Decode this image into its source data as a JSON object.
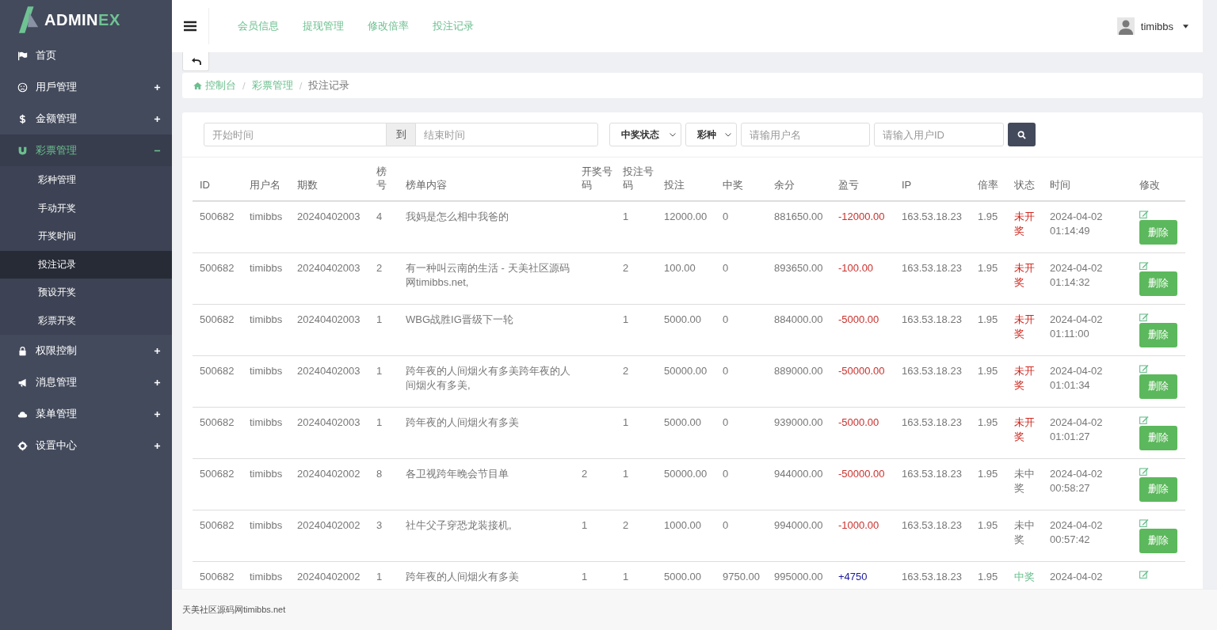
{
  "brand": {
    "name_main": "ADMIN",
    "name_accent": "EX"
  },
  "sidebar": {
    "items": [
      {
        "label": "首页",
        "expandable": false,
        "expanded": false
      },
      {
        "label": "用戶管理",
        "expandable": true,
        "expanded": false
      },
      {
        "label": "金额管理",
        "expandable": true,
        "expanded": false
      },
      {
        "label": "彩票管理",
        "expandable": true,
        "expanded": true,
        "children": [
          {
            "label": "彩种管理",
            "selected": false
          },
          {
            "label": "手动开奖",
            "selected": false
          },
          {
            "label": "开奖时间",
            "selected": false
          },
          {
            "label": "投注记录",
            "selected": true
          },
          {
            "label": "预设开奖",
            "selected": false
          },
          {
            "label": "彩票开奖",
            "selected": false
          }
        ]
      },
      {
        "label": "权限控制",
        "expandable": true,
        "expanded": false
      },
      {
        "label": "消息管理",
        "expandable": true,
        "expanded": false
      },
      {
        "label": "菜单管理",
        "expandable": true,
        "expanded": false
      },
      {
        "label": "设置中心",
        "expandable": true,
        "expanded": false
      }
    ]
  },
  "top_nav": {
    "links": [
      "会员信息",
      "提现管理",
      "修改倍率",
      "投注记录"
    ],
    "user": "timibbs"
  },
  "breadcrumb": {
    "separator": "/",
    "items": [
      {
        "label": "控制台",
        "current": false
      },
      {
        "label": "彩票管理",
        "current": false
      },
      {
        "label": "投注记录",
        "current": true
      }
    ]
  },
  "filters": {
    "start_time": {
      "placeholder": "开始时间"
    },
    "range_separator": "到",
    "end_time": {
      "placeholder": "结束时间"
    },
    "win_status_select": "中奖状态",
    "lottery_select": "彩种",
    "username": {
      "placeholder": "请输用户名"
    },
    "user_id": {
      "placeholder": "请输入用户ID"
    }
  },
  "table": {
    "columns": [
      "ID",
      "用户名",
      "期数",
      "榜号",
      "榜单内容",
      "开奖号码",
      "投注号码",
      "投注",
      "中奖",
      "余分",
      "盈亏",
      "IP",
      "倍率",
      "状态",
      "时间",
      "修改"
    ],
    "rows": [
      {
        "cells": [
          "500682",
          "timibbs",
          "20240402003",
          "4",
          "我妈是怎么相中我爸的",
          "",
          "1",
          "12000.00",
          "0",
          "881650.00"
        ],
        "profit": {
          "value": "-12000.00",
          "kind": "loss"
        },
        "ip": "163.53.18.23",
        "rate": "1.95",
        "status": {
          "label": "未开奖",
          "kind": "pending"
        },
        "time_lines": [
          "2024-04-02",
          "01:14:49"
        ],
        "delete_button": "删除"
      },
      {
        "cells": [
          "500682",
          "timibbs",
          "20240402003",
          "2",
          "有一种叫云南的生活 - 天美社区源码网timibbs.net,",
          "",
          "2",
          "100.00",
          "0",
          "893650.00"
        ],
        "profit": {
          "value": "-100.00",
          "kind": "loss"
        },
        "ip": "163.53.18.23",
        "rate": "1.95",
        "status": {
          "label": "未开奖",
          "kind": "pending"
        },
        "time_lines": [
          "2024-04-02",
          "01:14:32"
        ],
        "delete_button": "删除"
      },
      {
        "cells": [
          "500682",
          "timibbs",
          "20240402003",
          "1",
          "WBG战胜IG晋级下一轮",
          "",
          "1",
          "5000.00",
          "0",
          "884000.00"
        ],
        "profit": {
          "value": "-5000.00",
          "kind": "loss"
        },
        "ip": "163.53.18.23",
        "rate": "1.95",
        "status": {
          "label": "未开奖",
          "kind": "pending"
        },
        "time_lines": [
          "2024-04-02",
          "01:11:00"
        ],
        "delete_button": "删除"
      },
      {
        "cells": [
          "500682",
          "timibbs",
          "20240402003",
          "1",
          "跨年夜的人间烟火有多美跨年夜的人间烟火有多美,",
          "",
          "2",
          "50000.00",
          "0",
          "889000.00"
        ],
        "profit": {
          "value": "-50000.00",
          "kind": "loss"
        },
        "ip": "163.53.18.23",
        "rate": "1.95",
        "status": {
          "label": "未开奖",
          "kind": "pending"
        },
        "time_lines": [
          "2024-04-02",
          "01:01:34"
        ],
        "delete_button": "删除"
      },
      {
        "cells": [
          "500682",
          "timibbs",
          "20240402003",
          "1",
          "跨年夜的人间烟火有多美",
          "",
          "1",
          "5000.00",
          "0",
          "939000.00"
        ],
        "profit": {
          "value": "-5000.00",
          "kind": "loss"
        },
        "ip": "163.53.18.23",
        "rate": "1.95",
        "status": {
          "label": "未开奖",
          "kind": "pending"
        },
        "time_lines": [
          "2024-04-02",
          "01:01:27"
        ],
        "delete_button": "删除"
      },
      {
        "cells": [
          "500682",
          "timibbs",
          "20240402002",
          "8",
          "各卫视跨年晚会节目单",
          "2",
          "1",
          "50000.00",
          "0",
          "944000.00"
        ],
        "profit": {
          "value": "-50000.00",
          "kind": "loss"
        },
        "ip": "163.53.18.23",
        "rate": "1.95",
        "status": {
          "label": "未中奖",
          "kind": "lost"
        },
        "time_lines": [
          "2024-04-02",
          "00:58:27"
        ],
        "delete_button": "删除"
      },
      {
        "cells": [
          "500682",
          "timibbs",
          "20240402002",
          "3",
          "社牛父子穿恐龙装接机,",
          "1",
          "2",
          "1000.00",
          "0",
          "994000.00"
        ],
        "profit": {
          "value": "-1000.00",
          "kind": "loss"
        },
        "ip": "163.53.18.23",
        "rate": "1.95",
        "status": {
          "label": "未中奖",
          "kind": "lost"
        },
        "time_lines": [
          "2024-04-02",
          "00:57:42"
        ],
        "delete_button": "删除"
      },
      {
        "cells": [
          "500682",
          "timibbs",
          "20240402002",
          "1",
          "跨年夜的人间烟火有多美",
          "1",
          "1",
          "5000.00",
          "9750.00",
          "995000.00"
        ],
        "profit": {
          "value": "+4750",
          "kind": "gain"
        },
        "ip": "163.53.18.23",
        "rate": "1.95",
        "status": {
          "label": "中奖",
          "kind": "won"
        },
        "time_lines": [
          "2024-04-02"
        ]
      }
    ]
  },
  "footer": "天美社区源码网timibbs.net"
}
